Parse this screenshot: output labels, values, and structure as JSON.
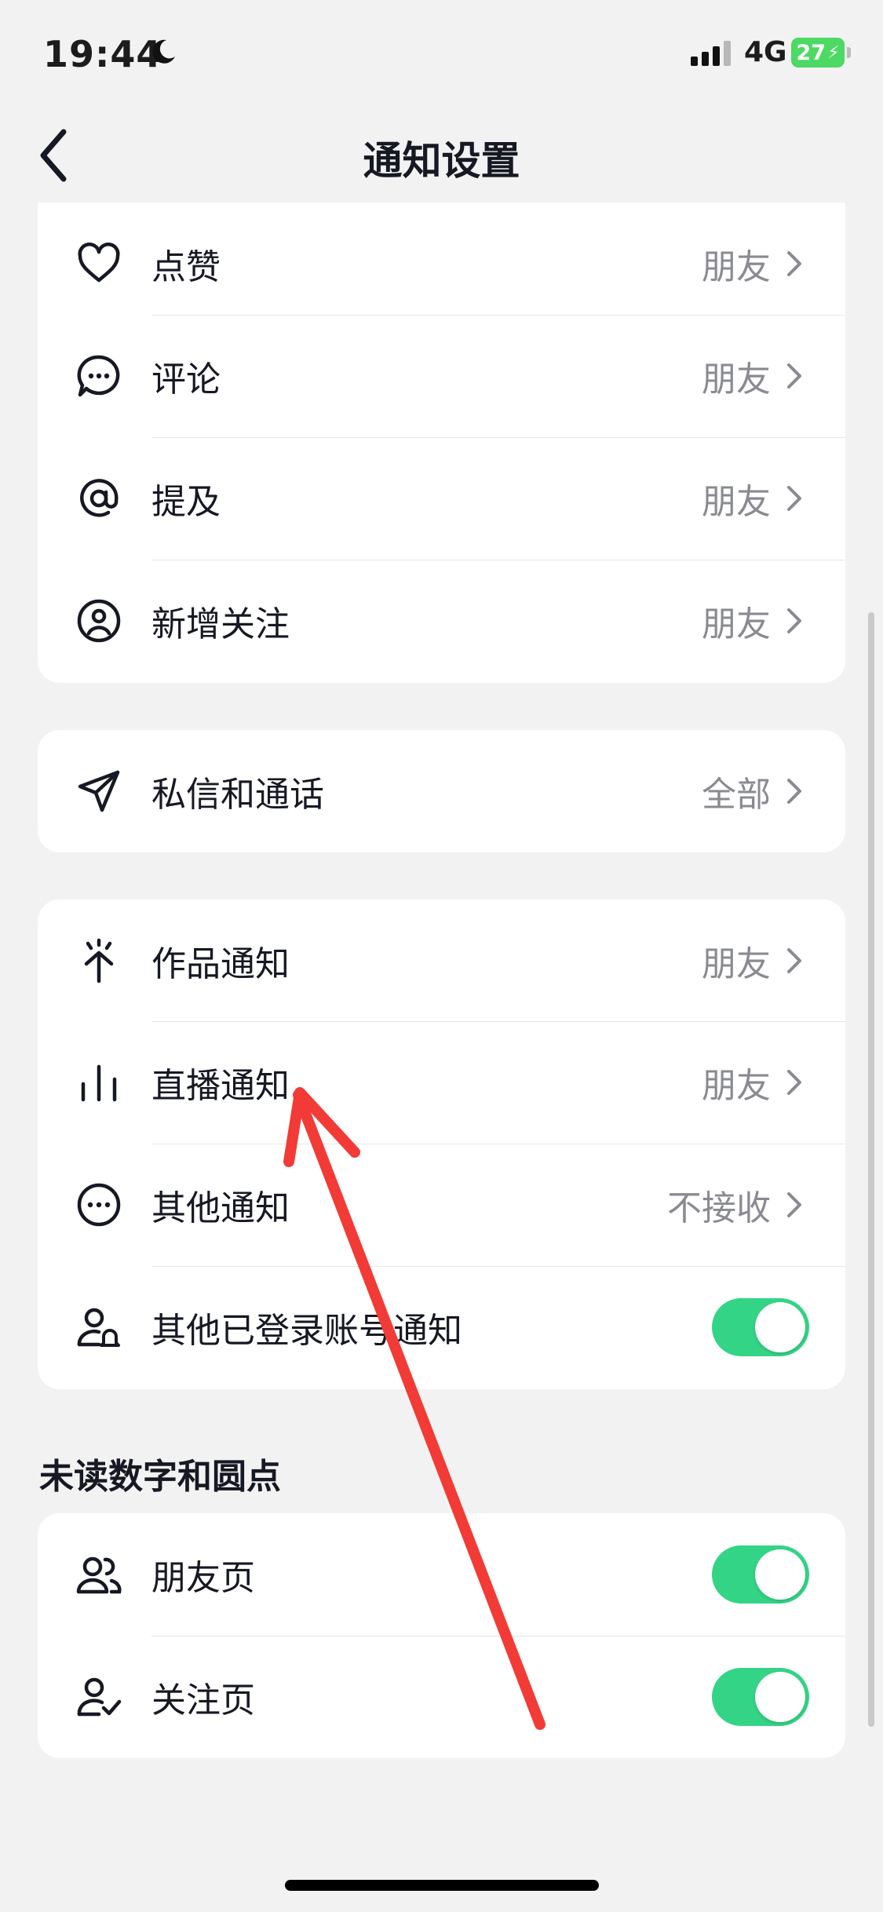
{
  "status_bar": {
    "time": "19:44",
    "network": "4G",
    "battery": "27",
    "moon_icon": "moon-icon",
    "signal_icon": "signal-icon"
  },
  "nav": {
    "title": "通知设置",
    "back_icon": "chevron-left-icon"
  },
  "interactions": {
    "items": [
      {
        "label": "点赞",
        "value": "朋友",
        "icon": "heart-icon"
      },
      {
        "label": "评论",
        "value": "朋友",
        "icon": "comment-icon"
      },
      {
        "label": "提及",
        "value": "朋友",
        "icon": "at-icon"
      },
      {
        "label": "新增关注",
        "value": "朋友",
        "icon": "user-circle-icon"
      }
    ]
  },
  "messages": {
    "items": [
      {
        "label": "私信和通话",
        "value": "全部",
        "icon": "send-icon"
      }
    ]
  },
  "content": {
    "items": [
      {
        "label": "作品通知",
        "value": "朋友",
        "icon": "sparkle-icon"
      },
      {
        "label": "直播通知",
        "value": "朋友",
        "icon": "live-bars-icon"
      },
      {
        "label": "其他通知",
        "value": "不接收",
        "icon": "more-circle-icon"
      }
    ],
    "toggle_item": {
      "label": "其他已登录账号通知",
      "on": true,
      "icon": "user-bell-icon"
    }
  },
  "unread": {
    "title": "未读数字和圆点",
    "items": [
      {
        "label": "朋友页",
        "on": true,
        "icon": "friends-icon"
      },
      {
        "label": "关注页",
        "on": true,
        "icon": "user-check-icon"
      }
    ]
  },
  "colors": {
    "background": "#f2f2f2",
    "card": "#ffffff",
    "toggle_on": "#34d486",
    "annotation_arrow": "#f23b36",
    "secondary_text": "#8a8b91"
  }
}
